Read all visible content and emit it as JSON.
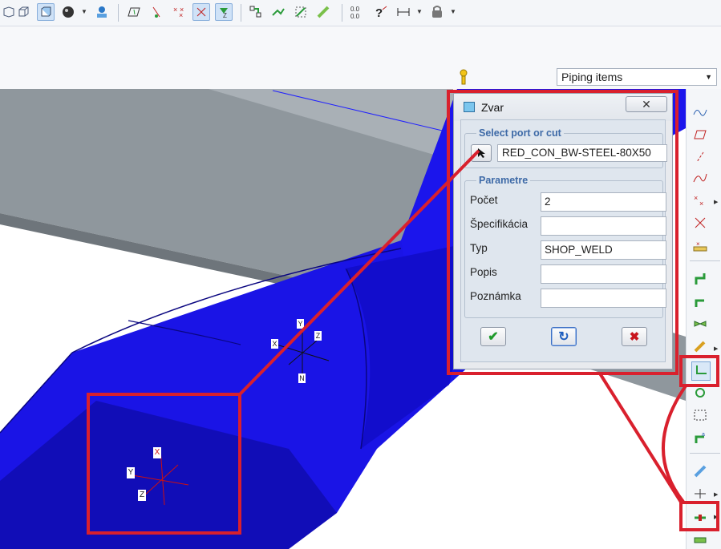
{
  "toolbar": {
    "icons": [
      "view-iso-icon",
      "wireframe-cube-icon",
      "solid-cube-icon",
      "shaded-sphere-icon",
      "render-settings-icon",
      "plane-icon",
      "hide-objects-icon",
      "points-icon",
      "axes-icon",
      "filter-icon",
      "connect-ports-icon",
      "route-icon",
      "edit-segment-icon",
      "measure-icon",
      "coordinates-icon",
      "query-icon",
      "dimension-icon",
      "lock-icon"
    ]
  },
  "selection": {
    "filter_value": "Piping items"
  },
  "dialog": {
    "title": "Zvar",
    "close_symbol": "✕",
    "group_select": {
      "legend": "Select port or cut",
      "value": "RED_CON_BW-STEEL-80X50"
    },
    "group_params": {
      "legend": "Parametre",
      "rows": [
        {
          "label": "Počet",
          "value": "2"
        },
        {
          "label": "Špecifikácia",
          "value": ""
        },
        {
          "label": "Typ",
          "value": "SHOP_WELD"
        },
        {
          "label": "Popis",
          "value": ""
        },
        {
          "label": "Poznámka",
          "value": ""
        }
      ]
    },
    "buttons": {
      "ok": "✔",
      "apply": "↻",
      "cancel": "✖"
    }
  },
  "viewport": {
    "axis_labels_upper": {
      "x": "X",
      "y": "Y",
      "z": "Z",
      "n": "N"
    },
    "axis_labels_lower": {
      "x": "X",
      "y": "Y",
      "z": "Z"
    },
    "colors": {
      "pipe": "#1a14e6",
      "pipe_dark": "#0b0790",
      "floor": "#8f979d",
      "annotation": "#d9202d"
    }
  },
  "rightbar": {
    "icons": [
      "spline-icon",
      "plane-tool-icon",
      "line-icon",
      "curve-icon",
      "points-tool-icon",
      "axes-tool-icon",
      "measure-tool-icon",
      "pipe-route-icon",
      "pipe-branch-icon",
      "valve-icon",
      "pencil-icon",
      "weld-icon",
      "connect-icon",
      "cut-icon",
      "insert-icon",
      "flex-pipe-icon",
      "split-icon",
      "weld-point-icon",
      "support-icon"
    ]
  }
}
